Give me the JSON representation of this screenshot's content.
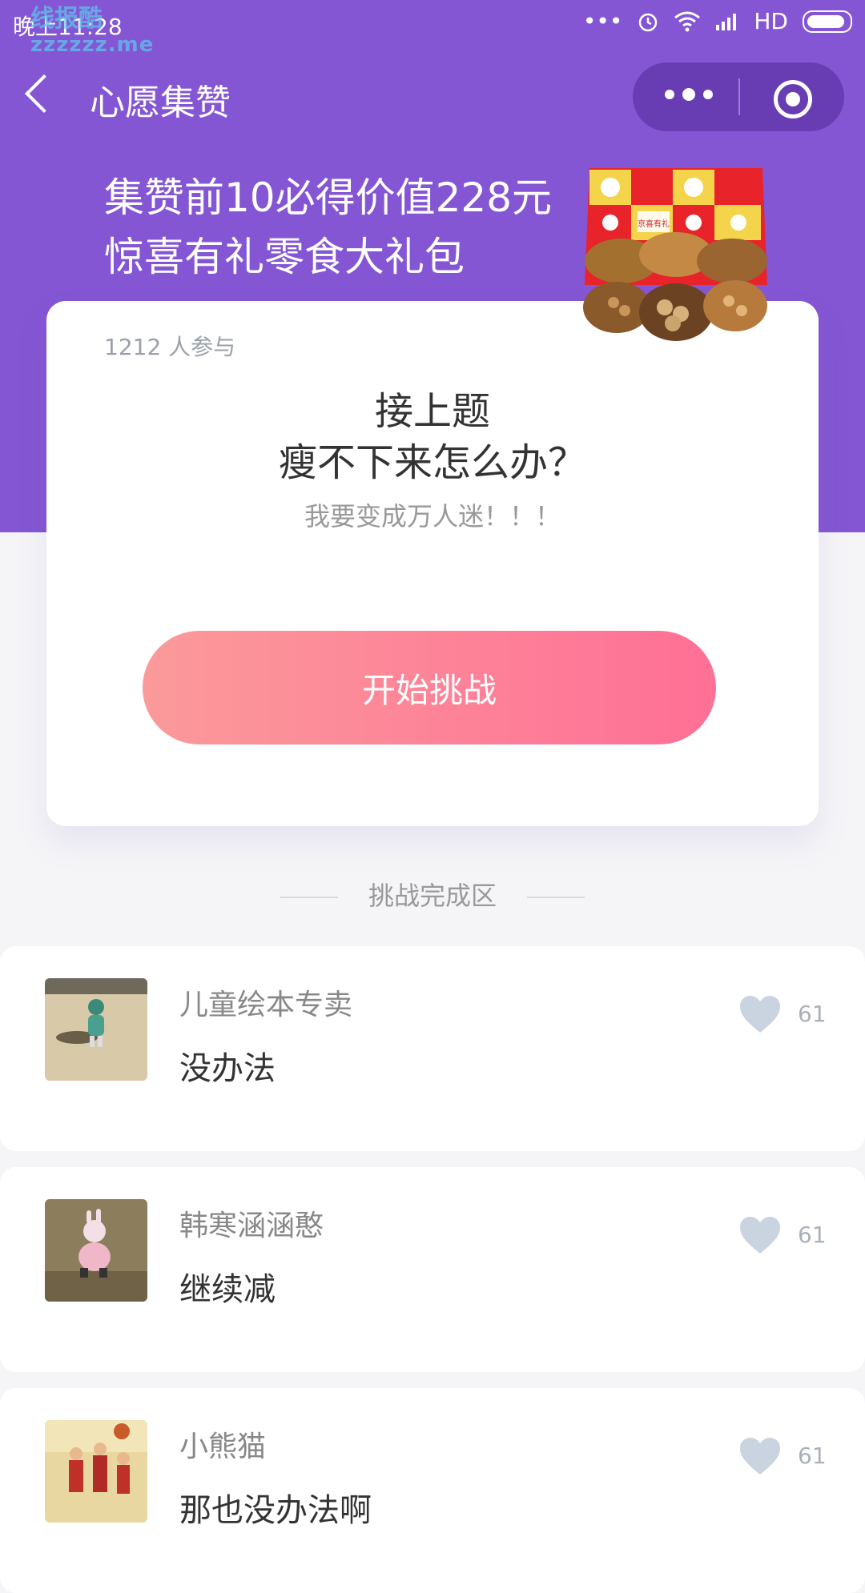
{
  "status_bar": {
    "time": "晚上11:28",
    "network": "HD",
    "watermark_line1": "线报酷",
    "watermark_line2": "zzzzzz.me"
  },
  "nav": {
    "title": "心愿集赞"
  },
  "banner": {
    "line1": "集赞前10必得价值228元",
    "line2": "惊喜有礼零食大礼包",
    "gift_box_label": "京喜有礼"
  },
  "card": {
    "participants": "1212 人参与",
    "question_line1": "接上题",
    "question_line2": "瘦不下来怎么办？",
    "subtext": "我要变成万人迷！！！",
    "start_button": "开始挑战"
  },
  "section": {
    "title": "挑战完成区"
  },
  "entries": [
    {
      "name": "儿童绘本专卖",
      "text": "没办法",
      "likes": "61"
    },
    {
      "name": "韩寒涵涵憨",
      "text": "继续减",
      "likes": "61"
    },
    {
      "name": "小熊猫",
      "text": "那也没办法啊",
      "likes": "61"
    }
  ],
  "colors": {
    "header_purple": "#8456d3",
    "button_gradient_start": "#fb9a9a",
    "button_gradient_end": "#ff6f96",
    "like_heart": "#c9d4e0"
  }
}
